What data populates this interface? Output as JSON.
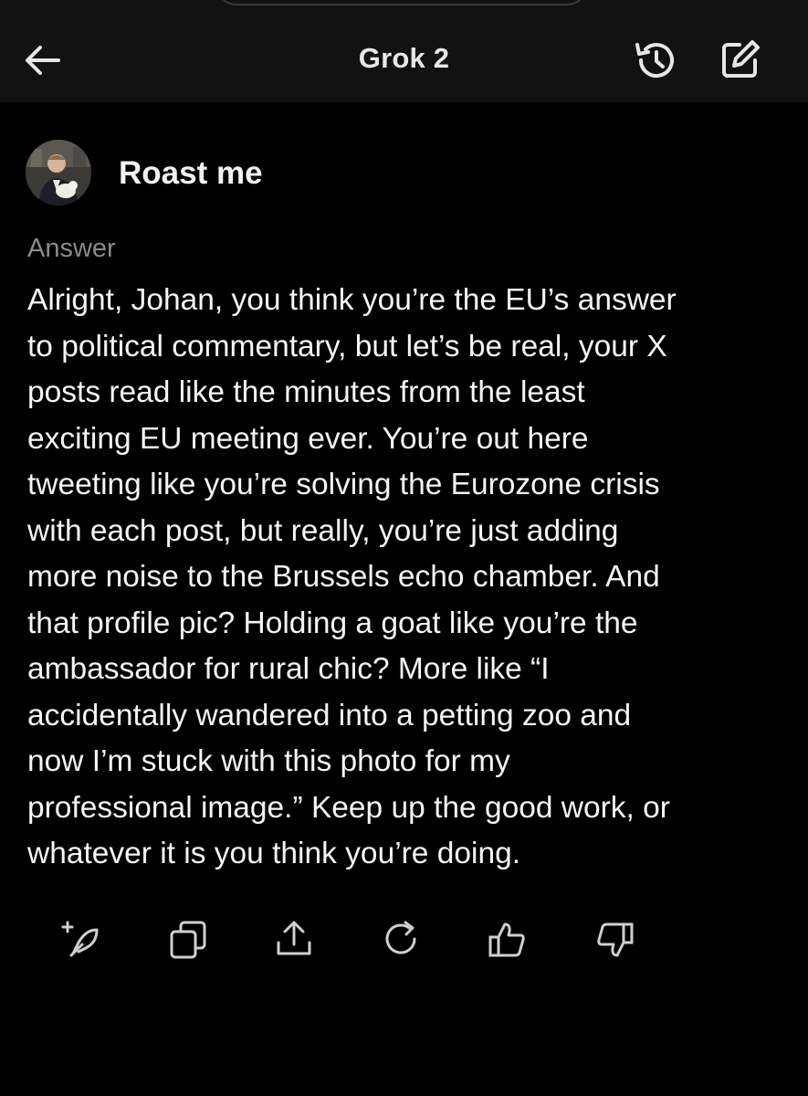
{
  "header": {
    "title": "Grok 2",
    "back_icon": "arrow-left-icon",
    "history_icon": "history-icon",
    "compose_icon": "compose-icon"
  },
  "conversation": {
    "prompt": "Roast me",
    "answer_label": "Answer",
    "answer_text": "Alright, Johan, you think you’re the EU’s answer\nto political commentary, but let’s be real, your X\nposts read like the minutes from the least\nexciting EU meeting ever. You’re out here\ntweeting like you’re solving the Eurozone crisis\nwith each post, but really, you’re just adding\nmore noise to the Brussels echo chamber. And\nthat profile pic? Holding a goat like you’re the\nambassador for rural chic? More like “I\naccidentally wandered into a petting zoo and\nnow I’m stuck with this photo for my\nprofessional image.” Keep up the good work, or\nwhatever it is you think you’re doing."
  },
  "actions": [
    {
      "icon": "regenerate-sparkle-icon"
    },
    {
      "icon": "copy-icon"
    },
    {
      "icon": "share-icon"
    },
    {
      "icon": "refresh-icon"
    },
    {
      "icon": "thumbs-up-icon"
    },
    {
      "icon": "thumbs-down-icon"
    }
  ],
  "colors": {
    "background": "#000000",
    "header_background": "#121212",
    "text": "#f5f5f5",
    "muted": "#8a8a8a",
    "icon": "#cfcfcf"
  }
}
